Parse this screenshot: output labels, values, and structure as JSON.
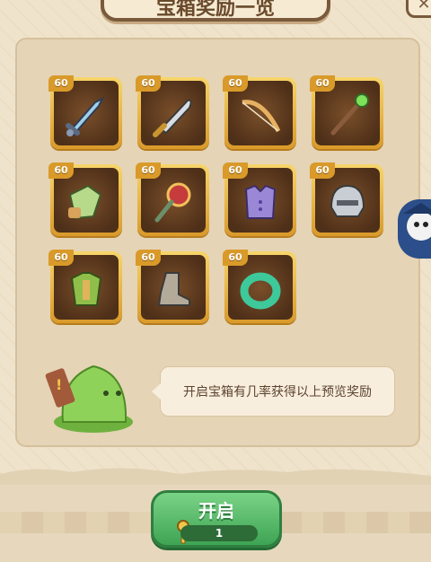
{
  "title": "宝箱奖励一览",
  "close_icon": "close-icon",
  "rewards": [
    {
      "level": "60",
      "icon": "sword-icon"
    },
    {
      "level": "60",
      "icon": "machete-icon"
    },
    {
      "level": "60",
      "icon": "bow-icon"
    },
    {
      "level": "60",
      "icon": "staff-icon"
    },
    {
      "level": "60",
      "icon": "leaf-armor-icon"
    },
    {
      "level": "60",
      "icon": "spiked-mace-icon"
    },
    {
      "level": "60",
      "icon": "vest-icon"
    },
    {
      "level": "60",
      "icon": "helmet-icon"
    },
    {
      "level": "60",
      "icon": "chest-armor-icon"
    },
    {
      "level": "60",
      "icon": "boots-icon"
    },
    {
      "level": "60",
      "icon": "jade-ring-icon"
    }
  ],
  "hint_text": "开启宝箱有几率获得以上预览奖励",
  "open_button": {
    "label": "开启",
    "cost": "1",
    "cost_icon": "key-icon"
  },
  "colors": {
    "accent": "#d99a2a",
    "button": "#4cb35e",
    "panel": "#e5d4b6"
  }
}
